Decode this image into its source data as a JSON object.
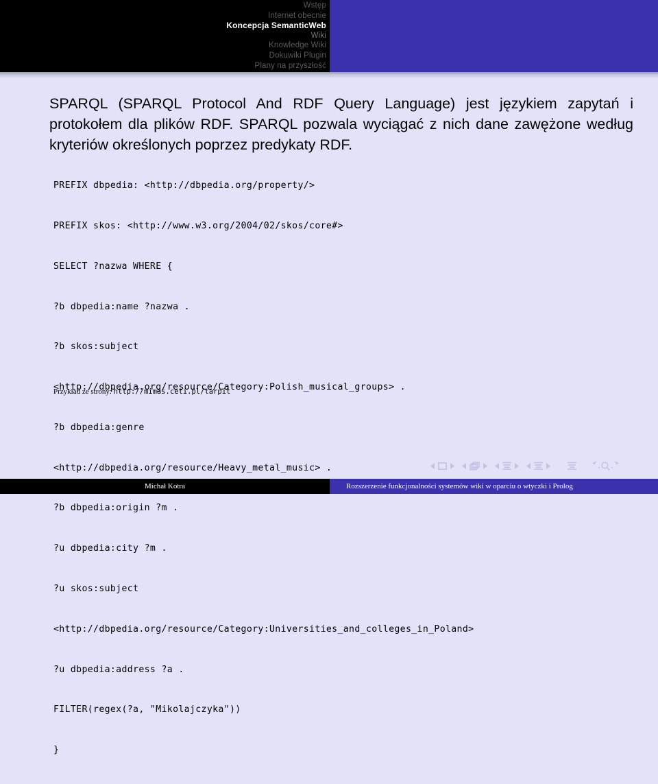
{
  "header": {
    "nav_items": [
      {
        "label": "Wstęp",
        "state": "inactive"
      },
      {
        "label": "Internet obecnie",
        "state": "inactive"
      },
      {
        "label": "Koncepcja SemanticWeb",
        "state": "active"
      },
      {
        "label": "Wiki",
        "state": "semi"
      },
      {
        "label": "Knowledge Wiki",
        "state": "inactive"
      },
      {
        "label": "Dokuwiki Plugin",
        "state": "inactive"
      },
      {
        "label": "Plany na przyszłość",
        "state": "inactive"
      }
    ]
  },
  "main": {
    "paragraph": "SPARQL (SPARQL Protocol And RDF Query Language) jest językiem zapytań i protokołem dla plików RDF. SPARQL pozwala wyciągać z nich dane zawężone według kryteriów określonych poprzez predykaty RDF.",
    "code_lines": [
      "PREFIX dbpedia: <http://dbpedia.org/property/>",
      "PREFIX skos: <http://www.w3.org/2004/02/skos/core#>",
      "SELECT ?nazwa WHERE {",
      "?b dbpedia:name ?nazwa .",
      "?b skos:subject",
      "<http://dbpedia.org/resource/Category:Polish_musical_groups> .",
      "?b dbpedia:genre",
      "<http://dbpedia.org/resource/Heavy_metal_music> .",
      "?b dbpedia:origin ?m .",
      "?u dbpedia:city ?m .",
      "?u skos:subject",
      "<http://dbpedia.org/resource/Category:Universities_and_colleges_in_Poland>",
      "?u dbpedia:address ?a .",
      "FILTER(regex(?a, \"Mikolajczyka\"))",
      "}"
    ],
    "caption_prefix": "Przykład ze strony: ",
    "caption_url": "http://mimas.ceti.pl/tarpit"
  },
  "navsymbols": {
    "items": [
      "prev-slide-icon",
      "slide-icon",
      "next-slide-icon",
      "prev-frame-icon",
      "frame-icon",
      "next-frame-icon",
      "prev-subsection-icon",
      "subsection-icon",
      "next-subsection-icon",
      "prev-section-icon",
      "section-icon",
      "next-section-icon",
      "presentation-icon",
      "back-icon",
      "search-icon",
      "forward-icon"
    ]
  },
  "footer": {
    "author": "Michał Kotra",
    "title": "Rozszerzenie funkcjonalności systemów wiki w oparciu o wtyczki i Prolog"
  },
  "colors": {
    "accent": "#3b31ac",
    "background": "#e2e2f8",
    "header_black": "#000000",
    "nav_symbol": "#c2c2e4"
  }
}
